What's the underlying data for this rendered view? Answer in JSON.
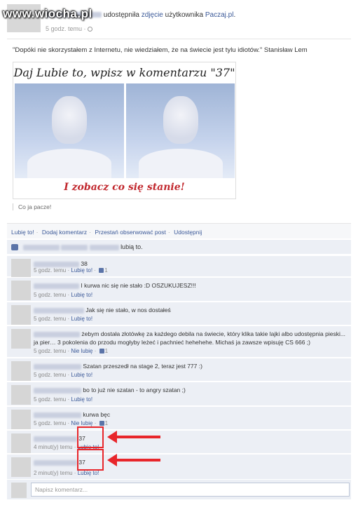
{
  "watermark": "www.wiocha.pl",
  "post": {
    "shared_text": "udostępniła",
    "shared_link": "zdjęcie",
    "user_text": "użytkownika",
    "page_link": "Paczaj.pl",
    "time": "5 godz. temu ·",
    "quote": "\"Dopóki nie skorzystałem z Internetu, nie wiedziałem, że na świecie jest tylu idiotów.\" Stanisław Lem",
    "image_top_text": "Daj Lubie to, wpisz w komentarzu \"37\"",
    "image_bottom_text": "I zobacz co się stanie!",
    "caption": "Co ja pacze!"
  },
  "actions": {
    "like": "Lubię to!",
    "comment": "Dodaj komentarz",
    "unfollow": "Przestań obserwować post",
    "share": "Udostępnij"
  },
  "likes_bar": {
    "text": "lubią to."
  },
  "comments": [
    {
      "text": "38",
      "time": "5 godz. temu ·",
      "like": "Lubię to!",
      "count": "1"
    },
    {
      "text": "I kurwa nic się nie stało :D OSZUKUJESZ!!!",
      "time": "5 godz. temu ·",
      "like": "Lubię to!",
      "count": ""
    },
    {
      "text": "Jak się nie stało, w nos dostałeś",
      "time": "5 godz. temu ·",
      "like": "Lubię to!",
      "count": ""
    },
    {
      "text": "żebym dostała złotówkę za każdego debila na świecie, który klika takie lajki albo udostępnia pieski... ja pier… 3 pokolenia do przodu mogłyby leżeć i pachnieć hehehehe. Michaś ja zawsze wpisuję CS 666 ;)",
      "time": "5 godz. temu ·",
      "like": "Nie lubię",
      "count": "1"
    },
    {
      "text": "Szatan przeszedł na stage 2, teraz jest 777 :)",
      "time": "5 godz. temu ·",
      "like": "Lubię to!",
      "count": ""
    },
    {
      "text": "bo to już nie szatan - to angry szatan ;)",
      "time": "5 godz. temu ·",
      "like": "Lubię to!",
      "count": ""
    },
    {
      "text": "kurwa bęc",
      "time": "5 godz. temu ·",
      "like": "Nie lubię",
      "count": "1"
    },
    {
      "text": "37",
      "time": "4 minut(y) temu ·",
      "like": "Lubię to!",
      "count": ""
    },
    {
      "text": "37",
      "time": "2 minut(y) temu ·",
      "like": "Lubię to!",
      "count": ""
    }
  ],
  "compose": {
    "placeholder": "Napisz komentarz..."
  },
  "colors": {
    "link": "#3b5998",
    "highlight": "#e8262b",
    "comment_bg": "#eceff5"
  }
}
